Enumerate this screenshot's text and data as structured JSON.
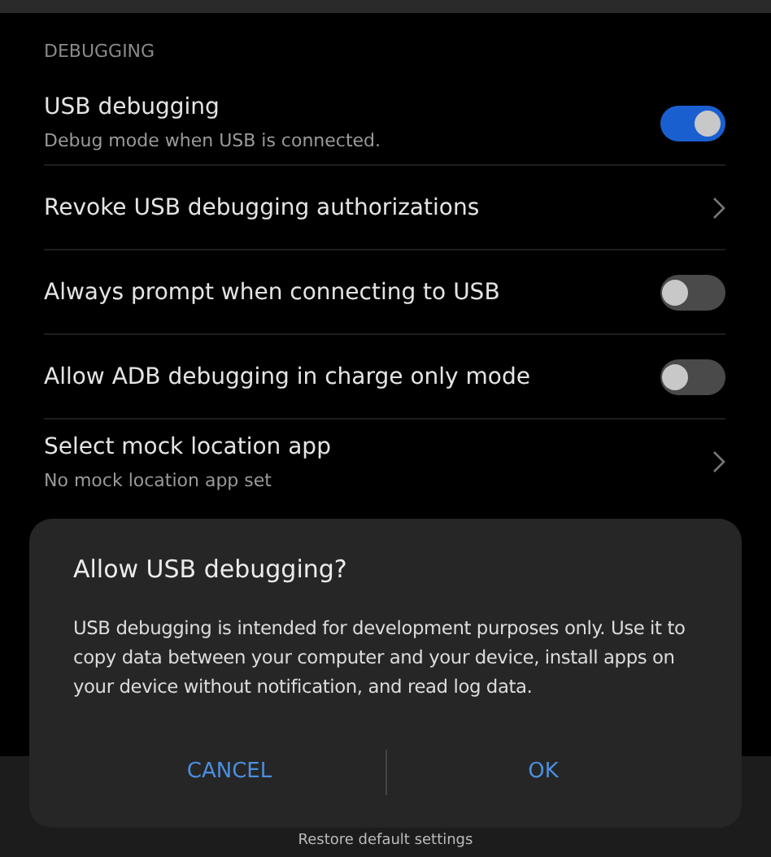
{
  "section_title": "DEBUGGING",
  "settings": [
    {
      "kind": "toggle",
      "title": "USB debugging",
      "subtitle": "Debug mode when USB is connected.",
      "on": true
    },
    {
      "kind": "link",
      "title": "Revoke USB debugging authorizations"
    },
    {
      "kind": "toggle",
      "title": "Always prompt when connecting to USB",
      "on": false
    },
    {
      "kind": "toggle",
      "title": "Allow ADB debugging in charge only mode",
      "on": false
    },
    {
      "kind": "link",
      "title": "Select mock location app",
      "subtitle": "No mock location app set"
    }
  ],
  "bottom_bar": {
    "label": "Restore default settings"
  },
  "dialog": {
    "title": "Allow USB debugging?",
    "message": "USB debugging is intended for development purposes only. Use it to copy data between your computer and your device, install apps on your device without notification, and read log data.",
    "buttons": [
      "CANCEL",
      "OK"
    ]
  }
}
